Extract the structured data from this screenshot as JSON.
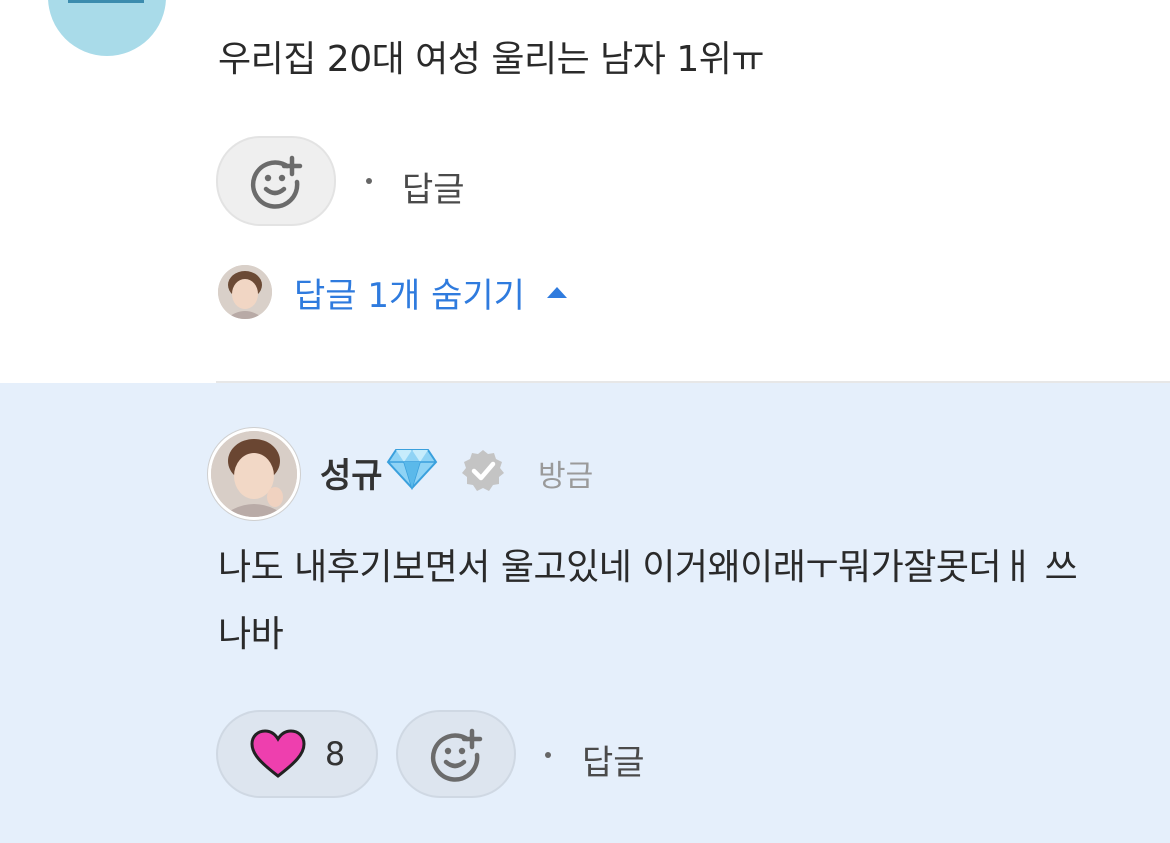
{
  "top_comment": {
    "text": "우리집 20대 여성 울리는 남자 1위ㅠ",
    "reply_label": "답글",
    "toggle_label": "답글 1개 숨기기"
  },
  "reply": {
    "author": "성규",
    "badge": "diamond-icon",
    "verified": "verified-check-icon",
    "time": "방금",
    "text": "나도 내후기보면서 울고있네 이거왜이래ㅜ뭐가잘못더ㅐ 쓰나바",
    "like_count": "8",
    "reply_label": "답글"
  },
  "colors": {
    "accent_blue": "#2f7bde",
    "reply_background": "#e5effb",
    "heart": "#ee3fae"
  }
}
